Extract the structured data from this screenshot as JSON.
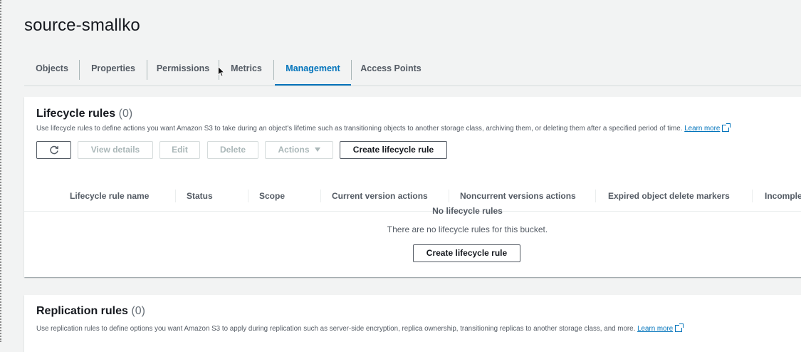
{
  "bucket": {
    "name": "source-smallko"
  },
  "tabs": [
    {
      "label": "Objects"
    },
    {
      "label": "Properties"
    },
    {
      "label": "Permissions"
    },
    {
      "label": "Metrics"
    },
    {
      "label": "Management",
      "active": true
    },
    {
      "label": "Access Points"
    }
  ],
  "lifecycle": {
    "title": "Lifecycle rules",
    "count": "(0)",
    "description": "Use lifecycle rules to define actions you want Amazon S3 to take during an object's lifetime such as transitioning objects to another storage class, archiving them, or deleting them after a specified period of time.",
    "learn_more": "Learn more",
    "buttons": {
      "view_details": "View details",
      "edit": "Edit",
      "delete": "Delete",
      "actions": "Actions",
      "create": "Create lifecycle rule"
    },
    "columns": [
      "Lifecycle rule name",
      "Status",
      "Scope",
      "Current version actions",
      "Noncurrent versions actions",
      "Expired object delete markers",
      "Incomple"
    ],
    "empty_title": "No lifecycle rules",
    "empty_text": "There are no lifecycle rules for this bucket.",
    "empty_button": "Create lifecycle rule"
  },
  "replication": {
    "title": "Replication rules",
    "count": "(0)",
    "description": "Use replication rules to define options you want Amazon S3 to apply during replication such as server-side encryption, replica ownership, transitioning replicas to another storage class, and more.",
    "learn_more": "Learn more"
  },
  "colors": {
    "accent": "#0073bb",
    "text": "#16191f",
    "muted": "#545b64",
    "background": "#f2f3f3"
  }
}
